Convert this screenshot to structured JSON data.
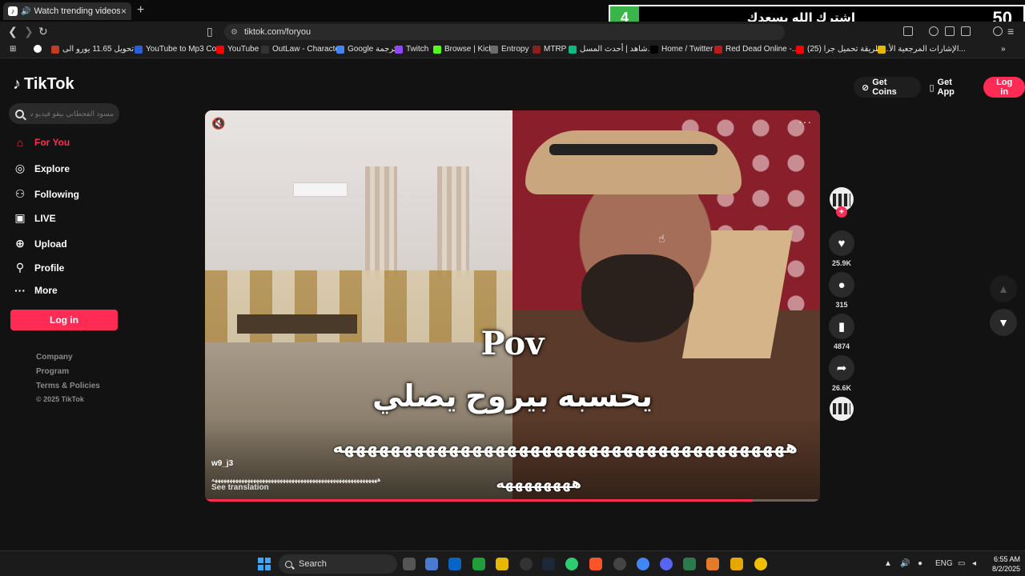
{
  "browser": {
    "tab_title": "Watch trending videos for yo",
    "tab_close": "×",
    "new_tab": "+",
    "url": "tiktok.com/foryou",
    "overlay_banner": {
      "badge": "4",
      "text": "اشترك الله يسعدك",
      "number": "50"
    },
    "bookmarks": [
      {
        "label": "تحويل 11.65 يورو الى...",
        "color": "#c23b22"
      },
      {
        "label": "YouTube to Mp3 Co...",
        "color": "#2b5fd9"
      },
      {
        "label": "YouTube",
        "color": "#ff0000"
      },
      {
        "label": "OutLaw - Character",
        "color": "#333333"
      },
      {
        "label": "Google ترجمة",
        "color": "#4285f4"
      },
      {
        "label": "Twitch",
        "color": "#9146ff"
      },
      {
        "label": "Browse | Kick",
        "color": "#53fc18"
      },
      {
        "label": "Entropy",
        "color": "#6c6c6c"
      },
      {
        "label": "MTRP",
        "color": "#8b1e1e"
      },
      {
        "label": "شاهد | أحدث المسل...",
        "color": "#10b981"
      },
      {
        "label": "Home / Twitter",
        "color": "#000000"
      },
      {
        "label": "Red Dead Online -...",
        "color": "#b91c1c"
      },
      {
        "label": "(25) طريقة تحميل جرا...",
        "color": "#ff0000"
      },
      {
        "label": "الإشارات المرجعية الأ...",
        "color": "#e6b800"
      }
    ]
  },
  "tiktok": {
    "logo": "TikTok",
    "search_placeholder": "مسود الفحطاني بيقو فيديو سحبه",
    "nav": [
      {
        "label": "For You",
        "icon": "home-icon",
        "active": true
      },
      {
        "label": "Explore",
        "icon": "compass-icon",
        "active": false
      },
      {
        "label": "Following",
        "icon": "user-follow-icon",
        "active": false
      },
      {
        "label": "LIVE",
        "icon": "live-icon",
        "active": false
      },
      {
        "label": "Upload",
        "icon": "upload-icon",
        "active": false
      },
      {
        "label": "Profile",
        "icon": "profile-icon",
        "active": false
      },
      {
        "label": "More",
        "icon": "more-icon",
        "active": false
      }
    ],
    "login_label": "Log in",
    "footer": {
      "company": "Company",
      "program": "Program",
      "terms": "Terms & Policies",
      "copyright": "© 2025 TikTok"
    },
    "top_right": {
      "get_coins": "Get Coins",
      "get_app": "Get App",
      "login": "Log in"
    },
    "video": {
      "pov": "Pov",
      "caption_ar": "يحسبه بيروح يصلي",
      "laugh_line1": "هههههههههههههههههههههههههههههههههههههههه",
      "laugh_line2": "ههههههههه",
      "author": "w9_j3",
      "description": "ههههههههههههههههههههههههههههههههههههههههههههههههههههههههه",
      "see_translation": "See translation",
      "progress": 0.89
    },
    "actions": {
      "likes": "25.9K",
      "comments": "315",
      "saves": "4874",
      "shares": "26.6K"
    }
  },
  "taskbar": {
    "search": "Search",
    "lang": "ENG",
    "time": "6:55 AM",
    "date": "8/2/2025"
  },
  "colors": {
    "accent": "#fe2c55",
    "background": "#121212"
  }
}
